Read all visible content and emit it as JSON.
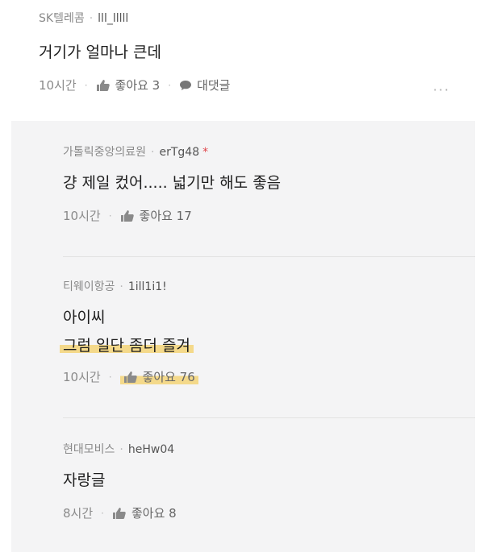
{
  "top_comment": {
    "company": "SK텔레콤",
    "nickname": "lll_lllll",
    "text": "거기가 얼마나 큰데",
    "time": "10시간",
    "likes": "좋아요 3",
    "reply_label": "대댓글",
    "more_glyph": "···"
  },
  "replies": [
    {
      "company": "가톨릭중앙의료원",
      "nickname": "erTg48",
      "badge": "*",
      "lines": [
        "걍 제일 컸어..... 넓기만 해도 좋음"
      ],
      "time": "10시간",
      "likes": "좋아요 17"
    },
    {
      "company": "티웨이항공",
      "nickname": "1ill1i1!",
      "lines": [
        "아이씨",
        "그럼 일단 좀더 즐겨"
      ],
      "time": "10시간",
      "likes": "좋아요 76"
    },
    {
      "company": "현대모비스",
      "nickname": "heHw04",
      "lines": [
        "자랑글"
      ],
      "time": "8시간",
      "likes": "좋아요 8"
    }
  ],
  "separator": "·",
  "colors": {
    "highlight": "#f4d98a",
    "reply_bg": "#f4f4f5",
    "badge": "#e0454a"
  }
}
